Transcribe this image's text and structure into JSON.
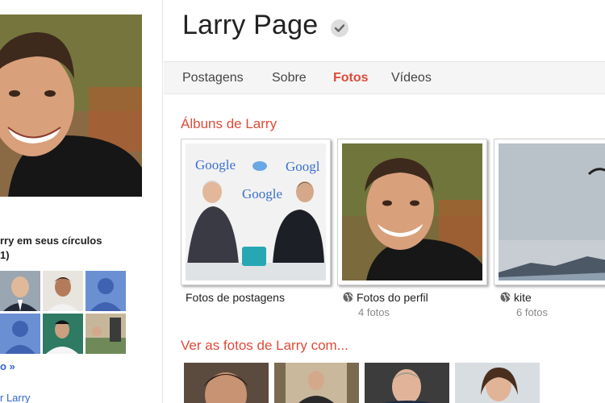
{
  "header": {
    "name": "Larry Page",
    "verified_icon": "checkmark-circle-icon"
  },
  "tabs": [
    {
      "label": "Postagens",
      "active": false
    },
    {
      "label": "Sobre",
      "active": false
    },
    {
      "label": "Fotos",
      "active": true
    },
    {
      "label": "Vídeos",
      "active": false
    }
  ],
  "sidebar": {
    "circles_title": "rry em seus círculos",
    "circles_count": "1)",
    "more_link": "o »",
    "bottom_link": "r Larry"
  },
  "albums_section": {
    "title": "Álbuns de Larry",
    "albums": [
      {
        "label": "Fotos de postagens",
        "count": ""
      },
      {
        "label": "Fotos do perfil",
        "count": "4 fotos",
        "icon": "globe-icon"
      },
      {
        "label": "kite",
        "count": "6 fotos",
        "icon": "globe-icon"
      }
    ],
    "album0_logos": [
      "Google",
      "Googl",
      "Google"
    ]
  },
  "photos_with": {
    "title": "Ver as fotos de Larry com..."
  },
  "colors": {
    "accent": "#dd4b39",
    "link": "#3366cc"
  }
}
